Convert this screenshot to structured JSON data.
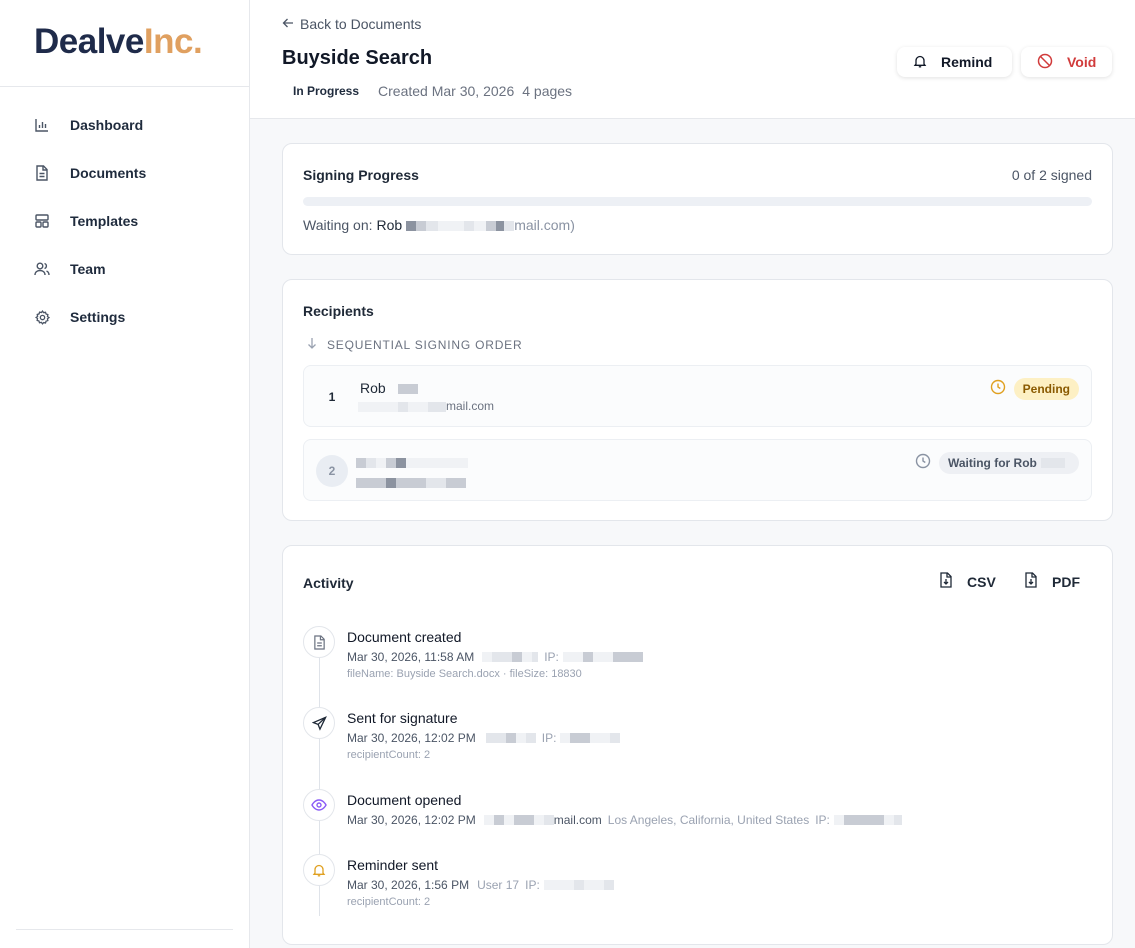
{
  "brand": {
    "name_part1": "Dealve",
    "name_part2": "Inc."
  },
  "sidebar": {
    "items": [
      {
        "label": "Dashboard",
        "icon": "bar-chart-icon"
      },
      {
        "label": "Documents",
        "icon": "document-icon"
      },
      {
        "label": "Templates",
        "icon": "template-icon"
      },
      {
        "label": "Team",
        "icon": "users-icon"
      },
      {
        "label": "Settings",
        "icon": "gear-icon"
      }
    ]
  },
  "header": {
    "back_label": "Back to Documents",
    "title": "Buyside Search",
    "status": "In Progress",
    "created": "Created Mar 30, 2026",
    "pages": "4 pages",
    "remind_label": "Remind",
    "void_label": "Void"
  },
  "progress": {
    "title": "Signing Progress",
    "count_label": "0 of 2 signed",
    "fraction": 0,
    "waiting_prefix": "Waiting on:",
    "waiting_name": "Rob",
    "waiting_email_tail": "mail.com)"
  },
  "recipients": {
    "title": "Recipients",
    "order_label": "SEQUENTIAL SIGNING ORDER",
    "list": [
      {
        "number": "1",
        "name": "Rob",
        "email_tail": "mail.com",
        "status": "Pending"
      },
      {
        "number": "2",
        "name": "",
        "email_tail": "",
        "status": "Waiting for Rob"
      }
    ]
  },
  "activity": {
    "title": "Activity",
    "csv_label": "CSV",
    "pdf_label": "PDF",
    "events": [
      {
        "title": "Document created",
        "time": "Mar 30, 2026, 11:58 AM",
        "ip_label": "IP:",
        "detail": "fileName: Buyside Search.docx · fileSize: 18830",
        "icon": "document-icon"
      },
      {
        "title": "Sent for signature",
        "time": "Mar 30, 2026, 12:02 PM",
        "ip_label": "IP:",
        "detail": "recipientCount: 2",
        "icon": "send-icon"
      },
      {
        "title": "Document opened",
        "time": "Mar 30, 2026, 12:02 PM",
        "email_tail": "mail.com",
        "location": "Los Angeles, California, United States",
        "ip_label": "IP:",
        "icon": "eye-icon"
      },
      {
        "title": "Reminder sent",
        "time": "Mar 30, 2026, 1:56 PM",
        "user": "User 17",
        "ip_label": "IP:",
        "detail": "recipientCount: 2",
        "icon": "bell-icon"
      }
    ]
  },
  "colors": {
    "brand_dark": "#1f2b4a",
    "brand_accent": "#e0a060",
    "void_red": "#d13b3b",
    "pending_bg": "#fdf0c4"
  }
}
